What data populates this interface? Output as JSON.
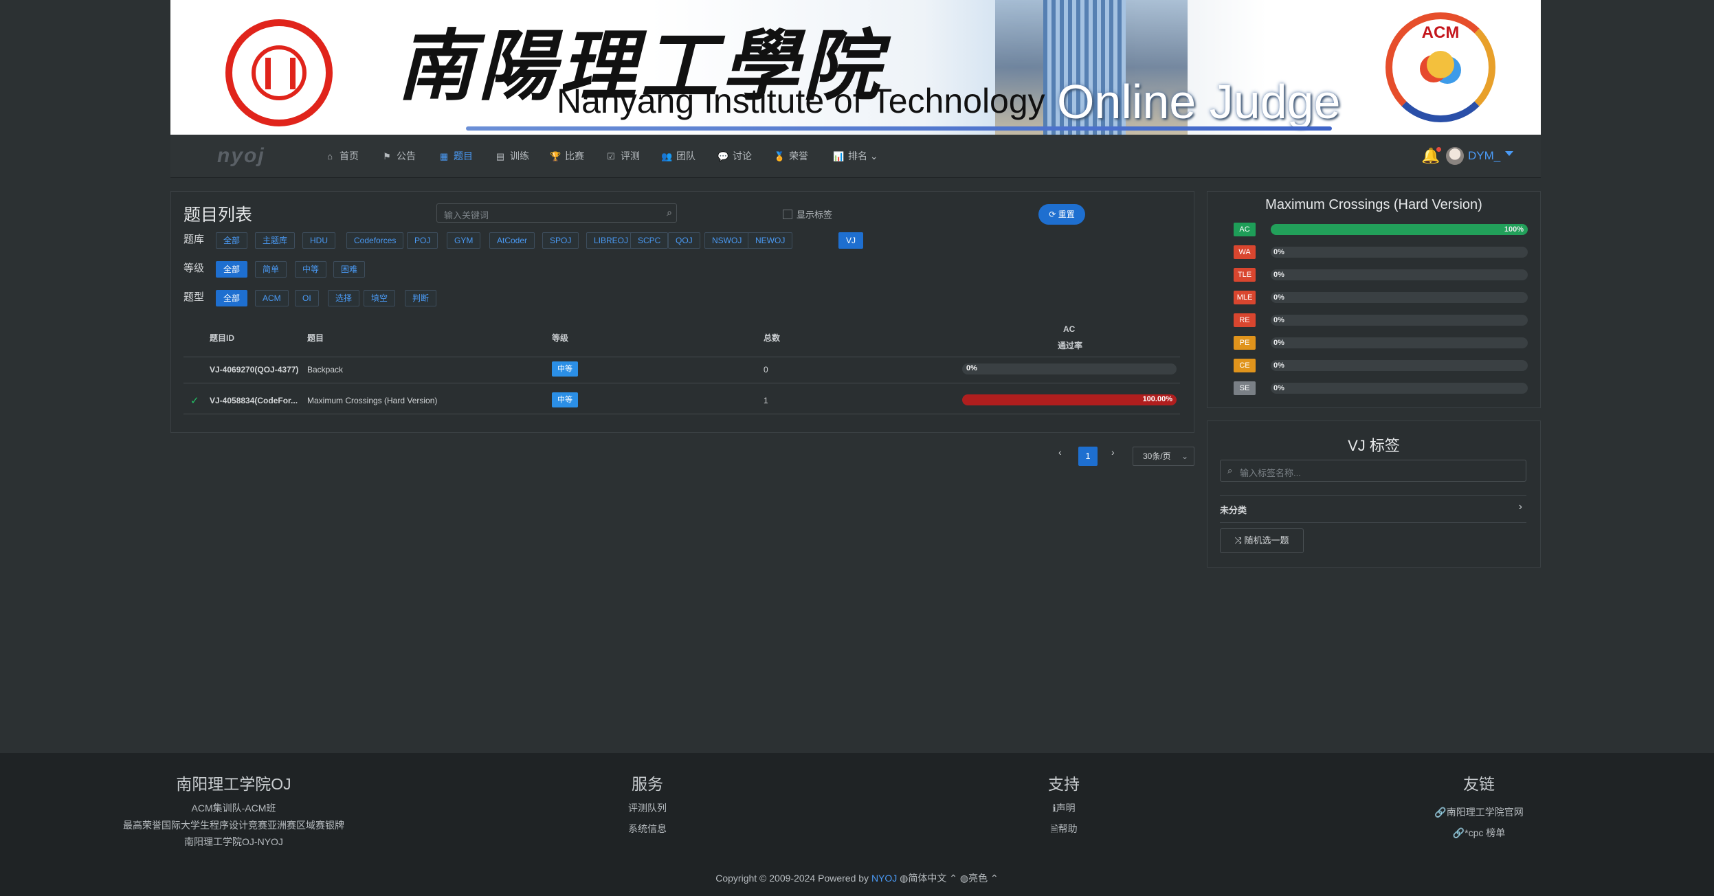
{
  "banner": {
    "cn_title": "南陽理工學院",
    "en_title": "Nanyang Institute of Technology",
    "oj_title": "Online Judge",
    "acm_text": "ACM"
  },
  "nav": {
    "logo": "nyoj",
    "items": [
      {
        "label": "首页",
        "icon": "home-icon"
      },
      {
        "label": "公告",
        "icon": "flag-icon"
      },
      {
        "label": "题目",
        "icon": "grid-icon",
        "active": true
      },
      {
        "label": "训练",
        "icon": "clipboard-icon"
      },
      {
        "label": "比赛",
        "icon": "trophy-icon"
      },
      {
        "label": "评测",
        "icon": "check-square-icon"
      },
      {
        "label": "团队",
        "icon": "users-icon"
      },
      {
        "label": "讨论",
        "icon": "comment-icon"
      },
      {
        "label": "荣誉",
        "icon": "medal-icon"
      },
      {
        "label": "排名",
        "icon": "bar-chart-icon"
      }
    ],
    "username": "DYM_"
  },
  "problems": {
    "title": "题目列表",
    "search_placeholder": "输入关键词",
    "show_tags": "显示标签",
    "reset": "重置",
    "bank_label": "题库",
    "banks": [
      "全部",
      "主题库",
      "HDU",
      "Codeforces",
      "POJ",
      "GYM",
      "AtCoder",
      "SPOJ",
      "LIBREOJ",
      "SCPC",
      "QOJ",
      "NSWOJ",
      "NEWOJ",
      "VJ"
    ],
    "bank_selected": "VJ",
    "level_label": "等级",
    "levels": [
      "全部",
      "简单",
      "中等",
      "困难"
    ],
    "level_selected": "全部",
    "type_label": "题型",
    "types": [
      "全部",
      "ACM",
      "OI",
      "选择",
      "填空",
      "判断"
    ],
    "type_selected": "全部",
    "columns": {
      "id": "题目ID",
      "title": "题目",
      "level": "等级",
      "total": "总数",
      "ac_rate_1": "AC",
      "ac_rate_2": "通过率"
    },
    "rows": [
      {
        "solved": false,
        "id": "VJ-4069270(QOJ-4377)",
        "title": "Backpack",
        "level": "中等",
        "total": "0",
        "rate_text": "0%",
        "rate": 0
      },
      {
        "solved": true,
        "id": "VJ-4058834(CodeFor...",
        "title": "Maximum Crossings (Hard Version)",
        "level": "中等",
        "total": "1",
        "rate_text": "100.00%",
        "rate": 1.0
      }
    ],
    "colors": {
      "rate_bar": "#b01e1e",
      "level_badge": "#2b8fe6"
    }
  },
  "pagination": {
    "prev": "‹",
    "current": "1",
    "next": "›",
    "page_size": "30条/页"
  },
  "stats": {
    "title": "Maximum Crossings (Hard Version)",
    "items": [
      {
        "label": "AC",
        "color": "#1e9e58",
        "pct_text": "100%",
        "pct": 1.0
      },
      {
        "label": "WA",
        "color": "#d9462f",
        "pct_text": "0%",
        "pct": 0
      },
      {
        "label": "TLE",
        "color": "#d9462f",
        "pct_text": "0%",
        "pct": 0
      },
      {
        "label": "MLE",
        "color": "#d9462f",
        "pct_text": "0%",
        "pct": 0
      },
      {
        "label": "RE",
        "color": "#d9462f",
        "pct_text": "0%",
        "pct": 0
      },
      {
        "label": "PE",
        "color": "#e0941c",
        "pct_text": "0%",
        "pct": 0
      },
      {
        "label": "CE",
        "color": "#e0941c",
        "pct_text": "0%",
        "pct": 0
      },
      {
        "label": "SE",
        "color": "#7a8086",
        "pct_text": "0%",
        "pct": 0
      }
    ]
  },
  "tags": {
    "title": "VJ 标签",
    "search_placeholder": "输入标签名称...",
    "category": "未分类",
    "random": "随机选一题"
  },
  "footer": {
    "col1": {
      "title": "南阳理工学院OJ",
      "lines": [
        "ACM集训队-ACM班",
        "最高荣誉国际大学生程序设计竞赛亚洲赛区域赛银牌",
        "南阳理工学院OJ-NYOJ"
      ]
    },
    "col2": {
      "title": "服务",
      "lines": [
        "评测队列",
        "系统信息"
      ]
    },
    "col3": {
      "title": "支持",
      "lines": [
        "声明",
        "帮助"
      ]
    },
    "col4": {
      "title": "友链",
      "lines": [
        "南阳理工学院官网",
        "*cpc 榜单"
      ]
    },
    "copyright_prefix": "Copyright © 2009-2024 Powered by",
    "brand": "NYOJ",
    "lang": "简体中文",
    "theme": "亮色"
  }
}
